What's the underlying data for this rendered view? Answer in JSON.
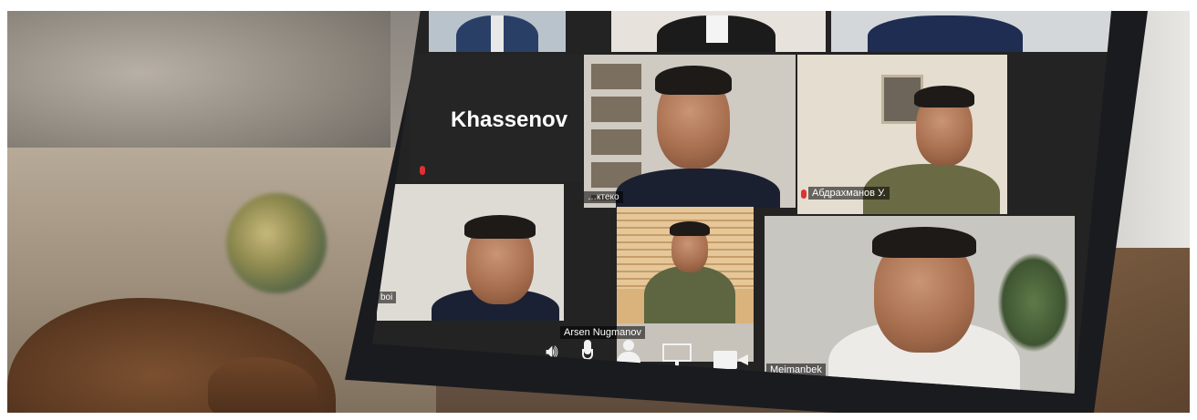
{
  "participants": [
    {
      "id": "khassenov",
      "name": "Khassenov",
      "video": false
    },
    {
      "id": "center-top",
      "name": "…ктеко",
      "video": true
    },
    {
      "id": "military-right",
      "name": "Абдрахманов У.",
      "video": true
    },
    {
      "id": "bottom-left",
      "name": "boi",
      "video": true
    },
    {
      "id": "arsen",
      "name": "Arsen Nugmanov",
      "video": true
    },
    {
      "id": "meimanbek",
      "name": "Meimanbek",
      "video": true
    }
  ],
  "toolbar": {
    "icons": [
      "speaker-icon",
      "microphone-icon",
      "participants-icon",
      "screen-share-icon",
      "camera-icon"
    ]
  },
  "colors": {
    "grid_bg": "#232323",
    "mic_muted": "#e03030"
  }
}
